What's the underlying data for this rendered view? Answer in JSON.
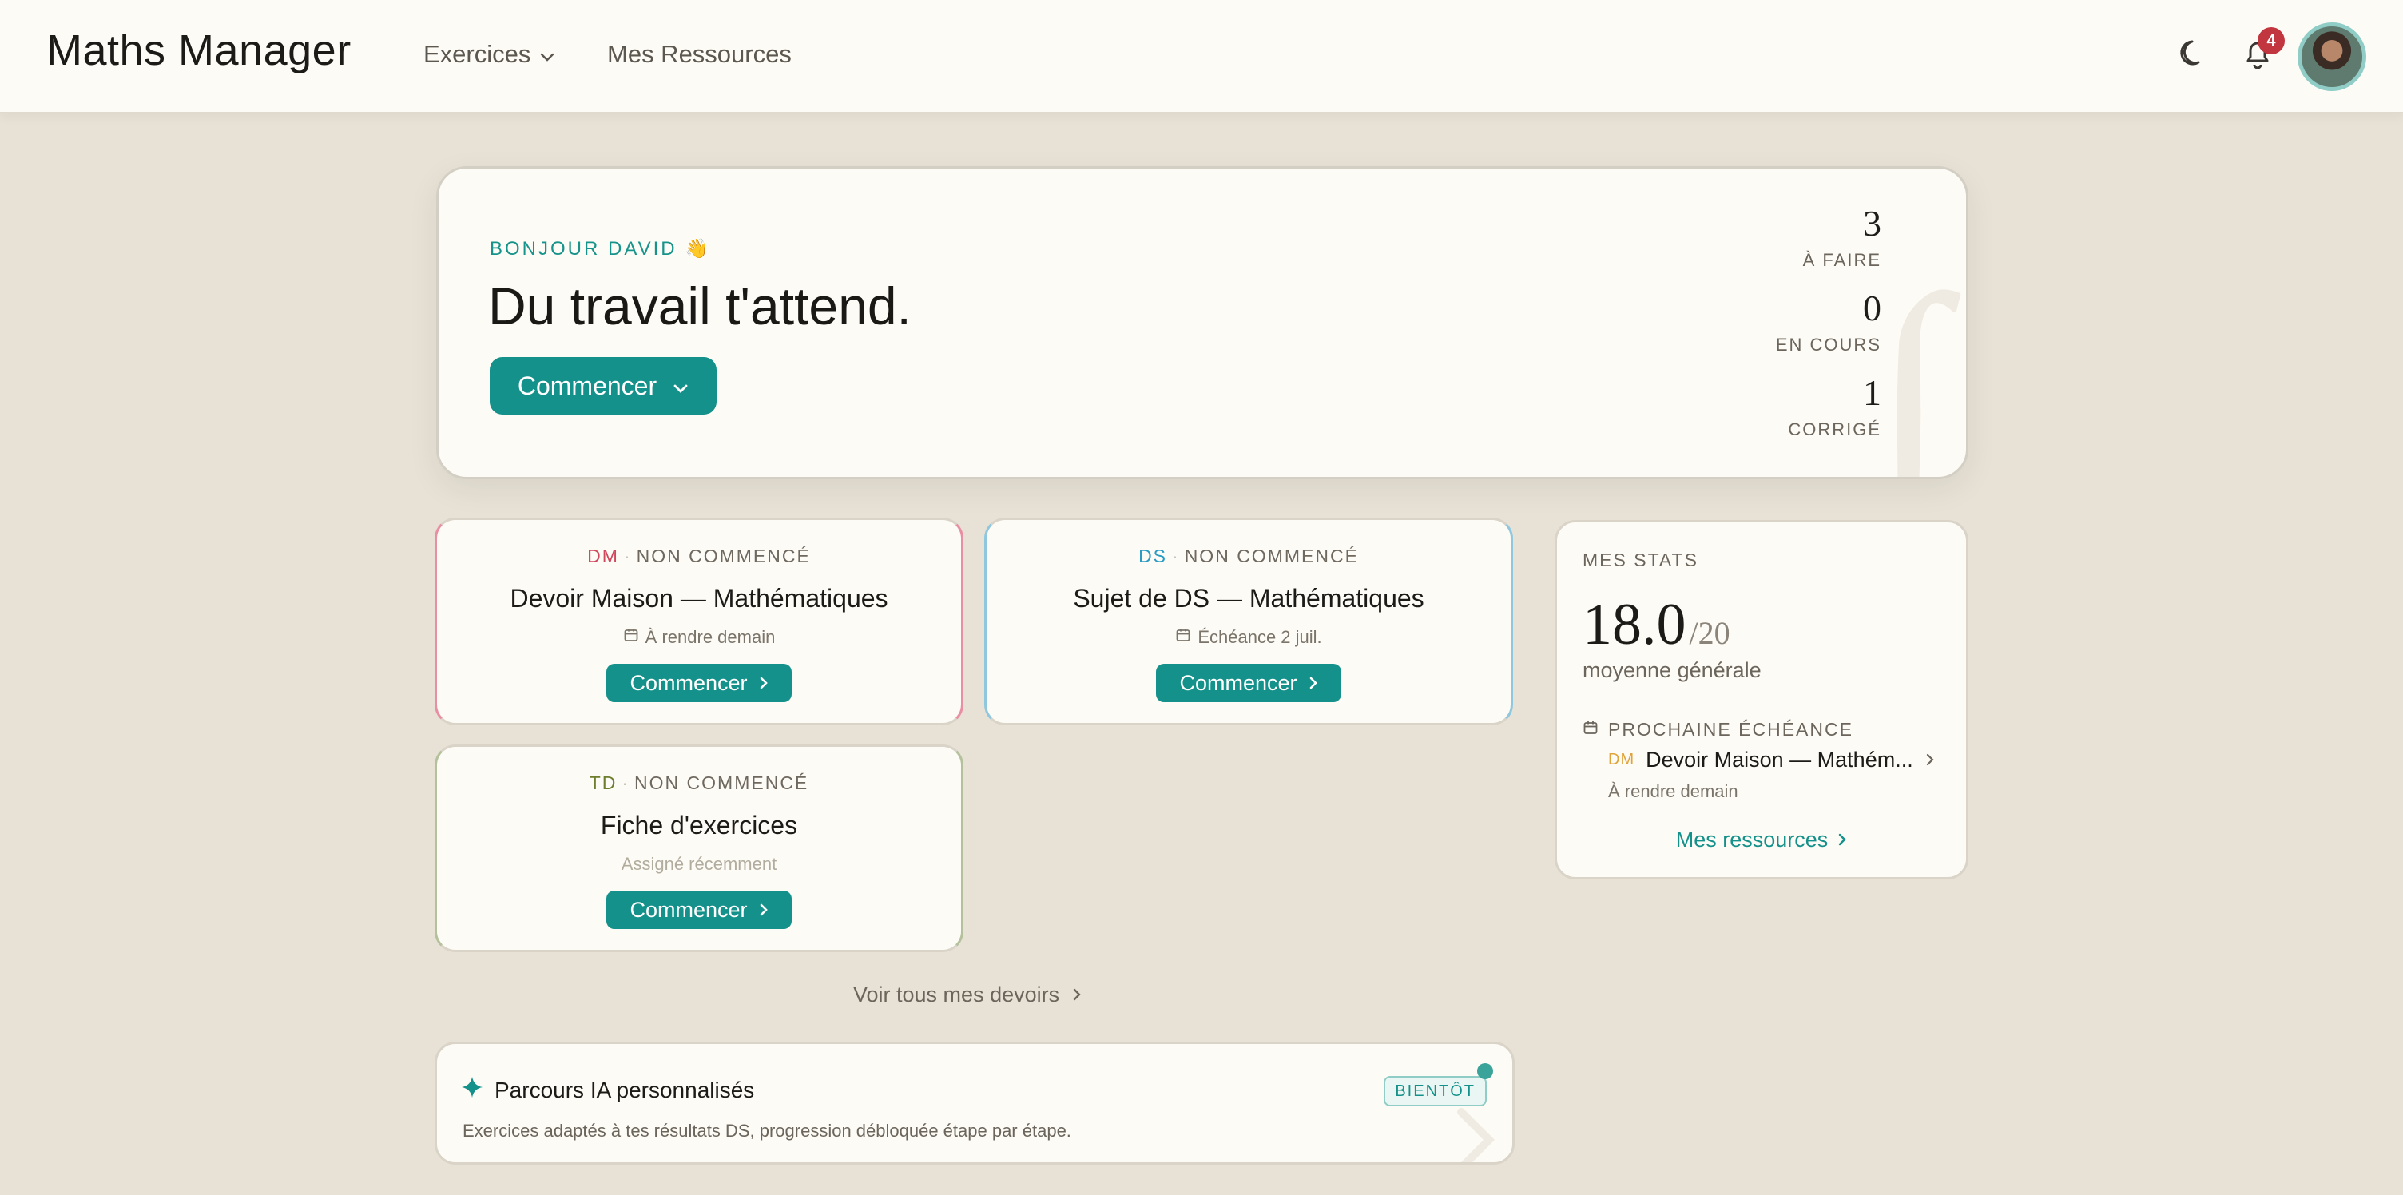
{
  "header": {
    "brand": "Maths Manager",
    "nav": [
      {
        "label": "Exercices"
      },
      {
        "label": "Mes Ressources"
      }
    ],
    "notification_count": "4"
  },
  "hero": {
    "greeting": "BONJOUR DAVID 👋",
    "title": "Du travail t'attend.",
    "cta": "Commencer",
    "stats": [
      {
        "value": "3",
        "label": "À FAIRE"
      },
      {
        "value": "0",
        "label": "EN COURS"
      },
      {
        "value": "1",
        "label": "CORRIGÉ"
      }
    ]
  },
  "assignments": [
    {
      "tag": "DM",
      "status": "NON COMMENCÉ",
      "title": "Devoir Maison — Mathématiques",
      "due": "À rendre demain",
      "cta": "Commencer"
    },
    {
      "tag": "DS",
      "status": "NON COMMENCÉ",
      "title": "Sujet de DS — Mathématiques",
      "due": "Échéance 2 juil.",
      "cta": "Commencer"
    },
    {
      "tag": "TD",
      "status": "NON COMMENCÉ",
      "title": "Fiche d'exercices",
      "due": "Assigné récemment",
      "cta": "Commencer"
    }
  ],
  "see_all": "Voir tous mes devoirs",
  "stats": {
    "label": "MES STATS",
    "score": "18.0",
    "out_of": "/20",
    "avg_label": "moyenne générale",
    "next_label": "PROCHAINE ÉCHÉANCE",
    "next_tag": "DM",
    "next_title": "Devoir Maison — Mathém...",
    "next_due": "À rendre demain",
    "link": "Mes ressources"
  },
  "ai": {
    "title": "Parcours IA personnalisés",
    "badge": "BIENTÔT",
    "description": "Exercices adaptés à tes résultats DS, progression débloquée étape par étape."
  },
  "colors": {
    "accent": "#14918a",
    "background": "#e8e2d6",
    "card": "#fdfbf5",
    "dm": "#d0485d",
    "ds": "#2a9bc4",
    "td": "#6d7f2f",
    "badge": "#c2363f"
  }
}
